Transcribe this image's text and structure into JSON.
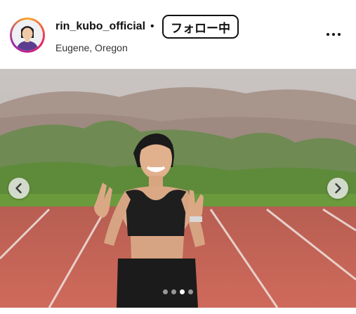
{
  "post": {
    "username": "rin_kubo_official",
    "separator": "•",
    "follow_label": "フォロー中",
    "location": "Eugene, Oregon",
    "more_icon": "more-horizontal-icon"
  },
  "carousel": {
    "prev_icon": "chevron-left-icon",
    "next_icon": "chevron-right-icon",
    "slide_count": 4,
    "active_index": 3
  },
  "colors": {
    "ring_gradient": [
      "#f9a825",
      "#e91e63",
      "#9c27b0"
    ],
    "track": "#c4574a",
    "grass": "#5e8b3a"
  }
}
